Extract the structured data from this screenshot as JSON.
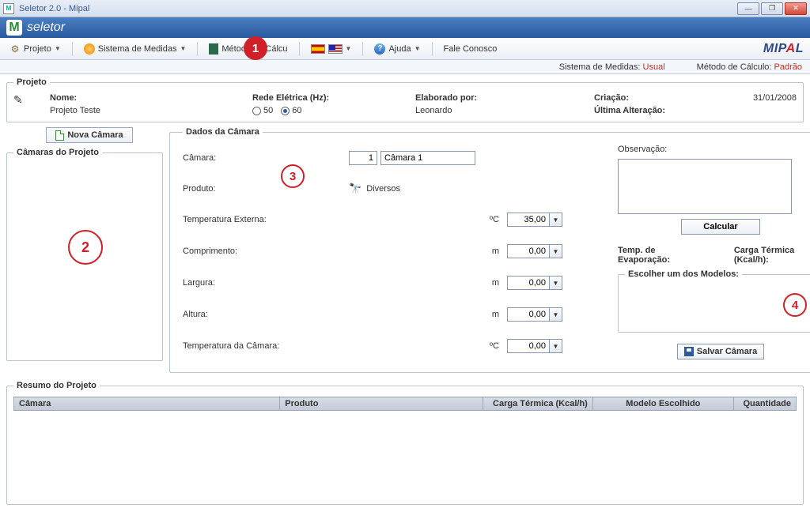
{
  "window": {
    "title": "Seletor 2.0 - Mipal",
    "app_icon_letter": "M"
  },
  "banner": {
    "text": "seletor"
  },
  "toolbar": {
    "projeto": "Projeto",
    "sistema": "Sistema de Medidas",
    "metodo": "Método de Cálcu",
    "ajuda": "Ajuda",
    "fale": "Fale Conosco"
  },
  "status": {
    "sistema_lbl": "Sistema de Medidas:",
    "sistema_val": "Usual",
    "metodo_lbl": "Método de Cálculo:",
    "metodo_val": "Padrão"
  },
  "projeto": {
    "legend": "Projeto",
    "nome_lbl": "Nome:",
    "nome_val": "Projeto Teste",
    "rede_lbl": "Rede Elétrica (Hz):",
    "opt50": "50",
    "opt60": "60",
    "elab_lbl": "Elaborado por:",
    "elab_val": "Leonardo",
    "criacao_lbl": "Criação:",
    "criacao_val": "31/01/2008",
    "ultalt_lbl": "Última Alteração:"
  },
  "nova_camara": "Nova Câmara",
  "camaras_legend": "Câmaras do Projeto",
  "dados": {
    "legend": "Dados da Câmara",
    "camara_lbl": "Câmara:",
    "camara_num": "1",
    "camara_nome": "Câmara 1",
    "produto_lbl": "Produto:",
    "produto_val": "Diversos",
    "temp_ext_lbl": "Temperatura Externa:",
    "temp_ext_unit": "ºC",
    "temp_ext_val": "35,00",
    "comp_lbl": "Comprimento:",
    "comp_unit": "m",
    "comp_val": "0,00",
    "larg_lbl": "Largura:",
    "larg_unit": "m",
    "larg_val": "0,00",
    "alt_lbl": "Altura:",
    "alt_unit": "m",
    "alt_val": "0,00",
    "temp_cam_lbl": "Temperatura da Câmara:",
    "temp_cam_unit": "ºC",
    "temp_cam_val": "0,00",
    "obs_lbl": "Observação:",
    "calcular": "Calcular",
    "temp_evap_lbl": "Temp. de Evaporação:",
    "carga_lbl": "Carga Térmica (Kcal/h):",
    "escolher_legend": "Escolher um dos Modelos:",
    "salvar": "Salvar Câmara"
  },
  "resumo": {
    "legend": "Resumo do Projeto",
    "col_camara": "Câmara",
    "col_produto": "Produto",
    "col_carga": "Carga Térmica (Kcal/h)",
    "col_modelo": "Modelo Escolhido",
    "col_qtd": "Quantidade"
  },
  "annotations": {
    "a1": "1",
    "a2": "2",
    "a3": "3",
    "a4": "4"
  }
}
